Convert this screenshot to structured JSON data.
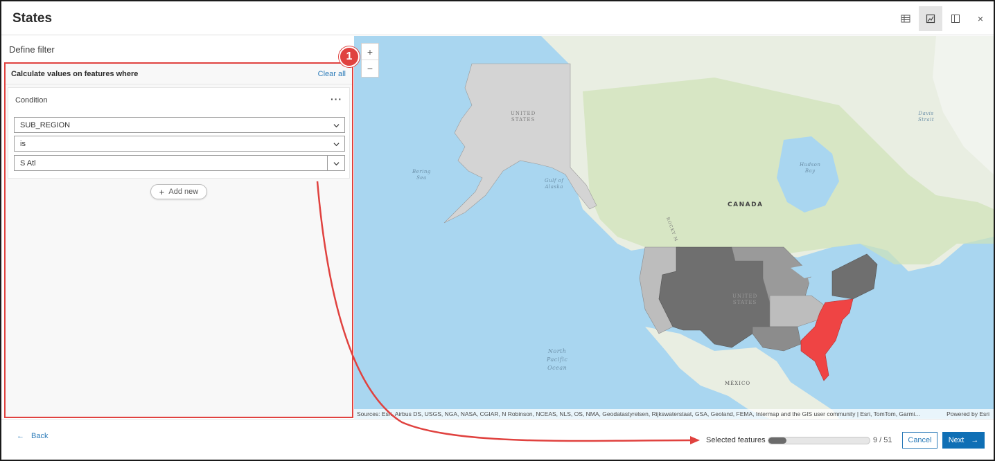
{
  "header": {
    "title": "States",
    "close_label": "×"
  },
  "left": {
    "section_title": "Define filter",
    "filter_heading": "Calculate values on features where",
    "clear_all": "Clear all",
    "condition": {
      "label": "Condition",
      "menu": "···",
      "field": "SUB_REGION",
      "operator": "is",
      "value": "S Atl"
    },
    "add_new": "Add new"
  },
  "annotation": {
    "step_number": "1",
    "color": "#e0423f"
  },
  "map": {
    "zoom_in": "+",
    "zoom_out": "−",
    "labels": {
      "alaska_line1": "UNITED",
      "alaska_line2": "STATES",
      "bering_line1": "Bering",
      "bering_line2": "Sea",
      "gulf_line1": "Gulf of",
      "gulf_line2": "Alaska",
      "canada": "CANADA",
      "hudson_line1": "Hudson",
      "hudson_line2": "Bay",
      "davis_line1": "Davis",
      "davis_line2": "Strait",
      "us_line1": "UNITED",
      "us_line2": "STATES",
      "pacific_line1": "North",
      "pacific_line2": "Pacific",
      "pacific_line3": "Ocean",
      "mexico": "MÉXICO",
      "rocky": "ROCKY M"
    },
    "attribution": "Sources: Esri, Airbus DS, USGS, NGA, NASA, CGIAR, N Robinson, NCEAS, NLS, OS, NMA, Geodatastyrelsen, Rijkswaterstaat, GSA, Geoland, FEMA, Intermap and the GIS user community | Esri, TomTom, Garmi...",
    "powered_by": "Powered by Esri",
    "colors": {
      "water": "#a9d6f0",
      "land": "#e9eee2",
      "green": "#cfe3b8",
      "selected": "#ef4444",
      "dark": "#6f6f6f",
      "mid": "#8c8c8c",
      "light": "#bdbdbd"
    }
  },
  "footer": {
    "back_arrow": "←",
    "back": "Back",
    "selected_label": "Selected features",
    "selected_count": "9 / 51",
    "selected_fraction": 0.176,
    "cancel": "Cancel",
    "next": "Next",
    "next_arrow": "→"
  }
}
